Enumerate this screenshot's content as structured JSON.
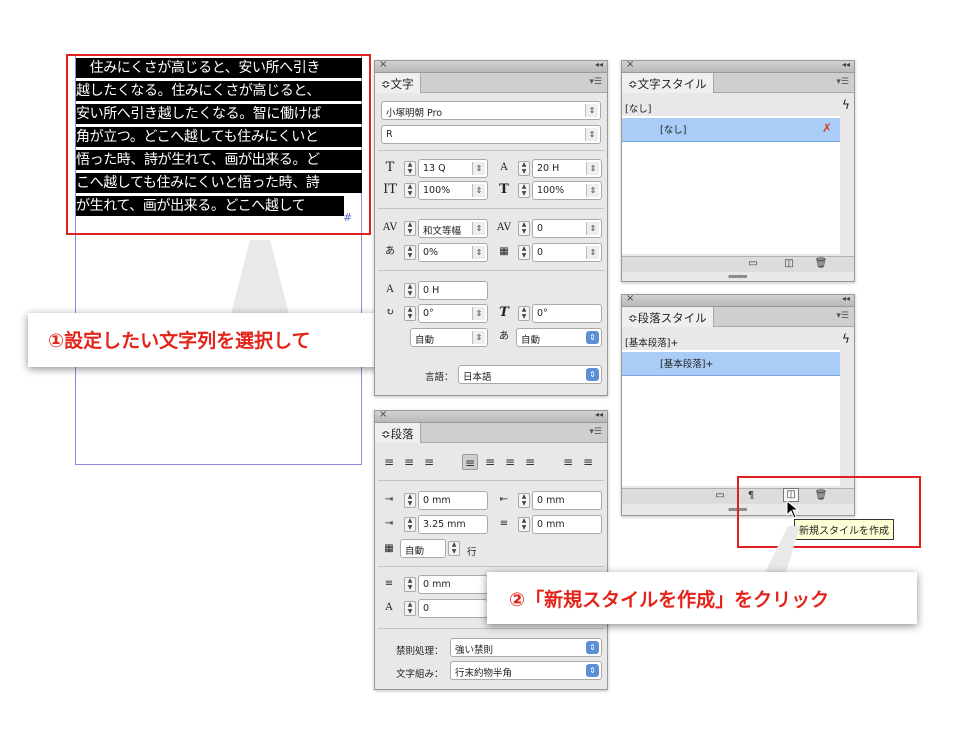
{
  "document": {
    "selected_text_lines": [
      "　住みにくさが高じると、安い所へ引き",
      "越したくなる。住みにくさが高じると、",
      "安い所へ引き越したくなる。智に働けば",
      "角が立つ。どこへ越しても住みにくいと",
      "悟った時、詩が生れて、画が出来る。ど",
      "こへ越しても住みにくいと悟った時、詩",
      "が生れて、画が出来る。どこへ越して"
    ],
    "overset_mark": "#"
  },
  "char_panel": {
    "close": "×",
    "collapse": "◂◂",
    "tab": "≎文字",
    "menu": "▾☰",
    "font_family": "小塚明朝 Pro",
    "font_style": "R",
    "size": "13 Q",
    "leading": "20 H",
    "vertical_scale": "100%",
    "horizontal_scale": "100%",
    "kerning": "和文等幅",
    "tracking": "0",
    "tsume": "0%",
    "baseline_grid": "0",
    "baseline_shift": "0 H",
    "rotation": "0°",
    "skew": "0°",
    "aki_before": "自動",
    "aki_after": "自動",
    "language_label": "言語：",
    "language": "日本語"
  },
  "para_panel": {
    "close": "×",
    "collapse": "◂◂",
    "tab": "≎段落",
    "menu": "▾☰",
    "left_indent": "0 mm",
    "right_indent": "0 mm",
    "first_line_indent": "3.25 mm",
    "last_line_indent": "0 mm",
    "dropcap_value": "自動",
    "dropcap_unit": "行",
    "space_before": "0 mm",
    "dropcap_lines": "0",
    "kinsoku_label": "禁則処理：",
    "kinsoku": "強い禁則",
    "mojikumi_label": "文字組み：",
    "mojikumi": "行末約物半角"
  },
  "char_style_panel": {
    "close": "×",
    "collapse": "◂◂",
    "tab": "≎文字スタイル",
    "menu": "▾☰",
    "current": "[なし]",
    "items": [
      "[なし]"
    ]
  },
  "para_style_panel": {
    "close": "×",
    "collapse": "◂◂",
    "tab": "≎段落スタイル",
    "menu": "▾☰",
    "current": "[基本段落]+",
    "items": [
      "[基本段落]+"
    ]
  },
  "tooltip": "新規スタイルを作成",
  "callouts": {
    "step1": "①設定したい文字列を選択して",
    "step2": "②「新規スタイルを作成」をクリック"
  },
  "colors": {
    "accent_red": "#e3241b",
    "selection_blue": "#a9cdf7",
    "panel_bg": "#e8e8e8"
  }
}
